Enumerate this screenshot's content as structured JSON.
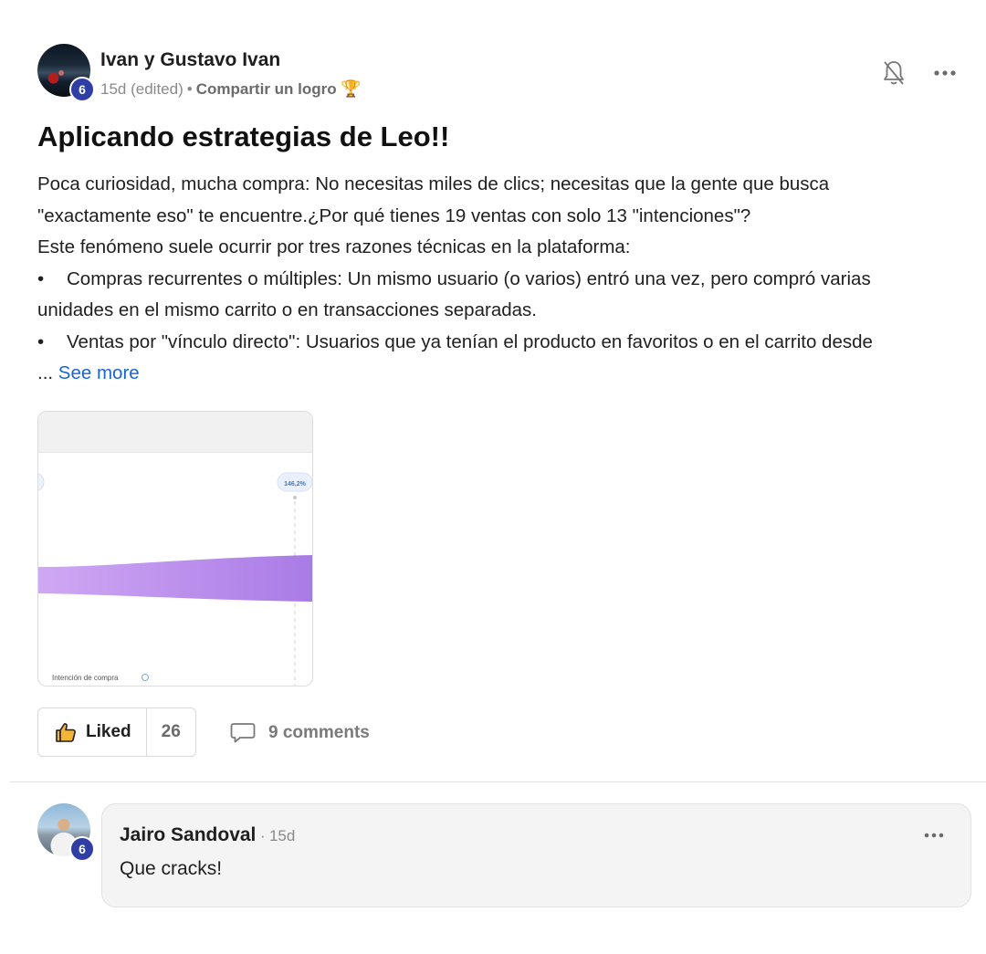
{
  "post": {
    "author": "Ivan y Gustavo Ivan",
    "level": "6",
    "time": "15d",
    "edited": "(edited)",
    "category": "Compartir un logro",
    "category_emoji": "🏆",
    "title": "Aplicando estrategias de Leo!!",
    "body_lines": [
      "Poca curiosidad, mucha compra: No necesitas miles de clics; necesitas que la gente que busca",
      "\"exactamente eso\" te encuentre.¿Por qué tienes 19 ventas con solo 13 \"intenciones\"?",
      "Este fenómeno suele ocurrir por tres razones técnicas en la plataforma:",
      "Compras recurrentes o múltiples: Un mismo usuario (o varios) entró una vez, pero compró varias",
      "unidades en el mismo carrito o en transacciones separadas.",
      "Ventas por \"vínculo directo\": Usuarios que ya tenían el producto en favoritos o en el carrito desde"
    ],
    "bullet_char": "•",
    "ellipsis": "...",
    "see_more": "See more",
    "image": {
      "badge_value": "146,2%",
      "label": "Intención de compra",
      "band_color_start": "#cfa8f3",
      "band_color_end": "#a97be6"
    },
    "like_label": "Liked",
    "like_count": "26",
    "comments_label": "9 comments",
    "icons": {
      "bell": "bell-off-icon",
      "more": "more-horizontal-icon",
      "like": "thumbs-up-icon",
      "comment": "comment-icon"
    }
  },
  "comment": {
    "author": "Jairo Sandoval",
    "level": "6",
    "separator": "·",
    "time": "15d",
    "text": "Que cracks!"
  },
  "colors": {
    "level_badge": "#2f3ea5",
    "link": "#1a66d1"
  }
}
